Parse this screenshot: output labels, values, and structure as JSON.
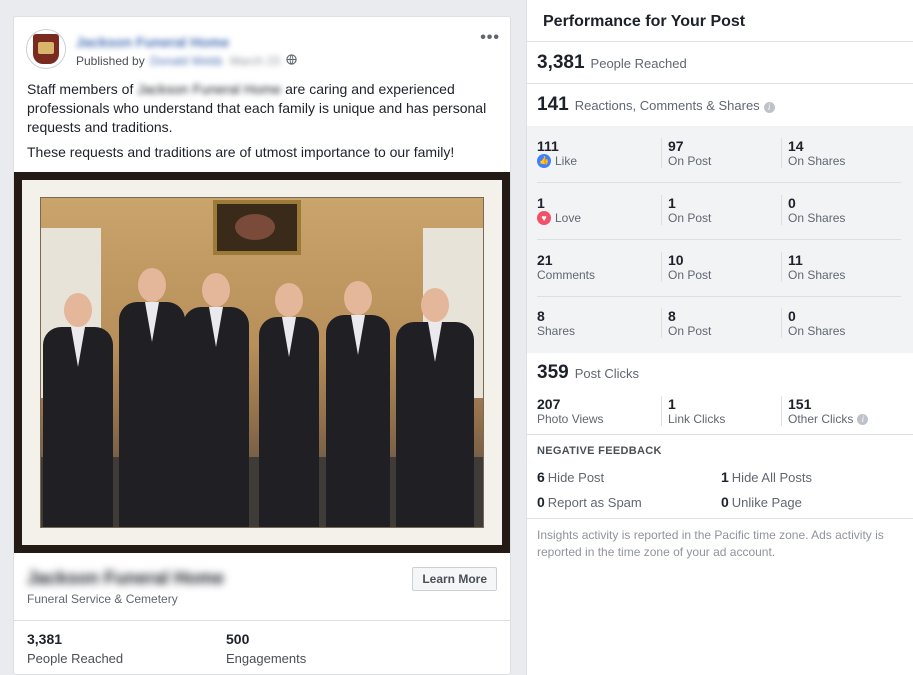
{
  "post": {
    "page_name": "Jackson Funeral Home",
    "published_prefix": "Published by",
    "published_by": "Donald Webb",
    "published_date": "March 23",
    "more_label": "•••",
    "text_p1_before": "Staff members of ",
    "text_p1_name": "Jackson Funeral Home",
    "text_p1_after": " are caring and experienced professionals who understand that each family is unique and has personal requests and traditions.",
    "text_p2": "These requests and traditions are of utmost importance to our family!",
    "link_title": "Jackson Funeral Home",
    "link_subtitle": "Funeral Service & Cemetery",
    "cta_label": "Learn More",
    "stats": [
      {
        "value": "3,381",
        "label": "People Reached"
      },
      {
        "value": "500",
        "label": "Engagements"
      }
    ]
  },
  "panel": {
    "title": "Performance for Your Post",
    "reached": {
      "value": "3,381",
      "label": "People Reached"
    },
    "reactions_total": {
      "value": "141",
      "label": "Reactions, Comments & Shares"
    },
    "rows": [
      {
        "c1": {
          "value": "111",
          "label": "Like"
        },
        "c2": {
          "value": "97",
          "label": "On Post"
        },
        "c3": {
          "value": "14",
          "label": "On Shares"
        }
      },
      {
        "c1": {
          "value": "1",
          "label": "Love"
        },
        "c2": {
          "value": "1",
          "label": "On Post"
        },
        "c3": {
          "value": "0",
          "label": "On Shares"
        }
      },
      {
        "c1": {
          "value": "21",
          "label": "Comments"
        },
        "c2": {
          "value": "10",
          "label": "On Post"
        },
        "c3": {
          "value": "11",
          "label": "On Shares"
        }
      },
      {
        "c1": {
          "value": "8",
          "label": "Shares"
        },
        "c2": {
          "value": "8",
          "label": "On Post"
        },
        "c3": {
          "value": "0",
          "label": "On Shares"
        }
      }
    ],
    "clicks": {
      "value": "359",
      "label": "Post Clicks",
      "items": [
        {
          "value": "207",
          "label": "Photo Views"
        },
        {
          "value": "1",
          "label": "Link Clicks"
        },
        {
          "value": "151",
          "label": "Other Clicks"
        }
      ]
    },
    "negative": {
      "title": "NEGATIVE FEEDBACK",
      "items": [
        {
          "value": "6",
          "label": "Hide Post"
        },
        {
          "value": "1",
          "label": "Hide All Posts"
        },
        {
          "value": "0",
          "label": "Report as Spam"
        },
        {
          "value": "0",
          "label": "Unlike Page"
        }
      ]
    },
    "footnote": "Insights activity is reported in the Pacific time zone. Ads activity is reported in the time zone of your ad account."
  },
  "icons": {
    "globe": "globe-icon",
    "like": "like-reaction-icon",
    "love": "love-reaction-icon",
    "info": "info-icon"
  },
  "colors": {
    "brand_blue": "#4a6fb5",
    "like_blue": "#4080ff",
    "love_red": "#f25268",
    "panel_grey": "#f2f3f5"
  }
}
